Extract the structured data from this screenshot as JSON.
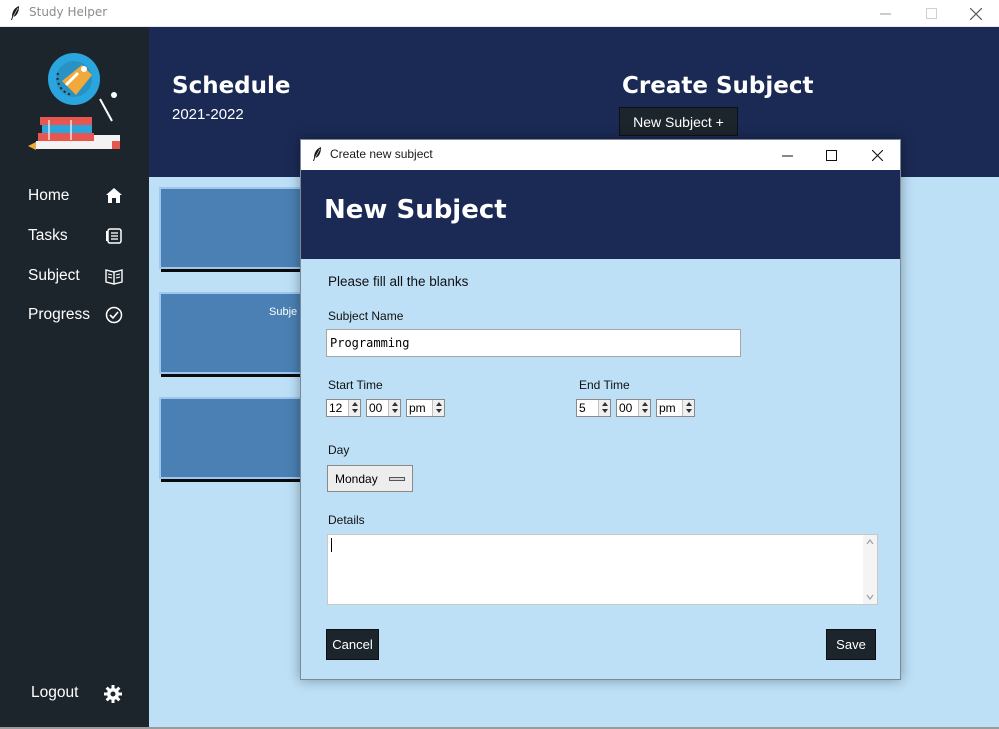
{
  "window": {
    "title": "Study Helper"
  },
  "sidebar": {
    "items": [
      {
        "label": "Home",
        "icon": "home-icon"
      },
      {
        "label": "Tasks",
        "icon": "tasks-icon"
      },
      {
        "label": "Subject",
        "icon": "book-icon"
      },
      {
        "label": "Progress",
        "icon": "check-circle-icon"
      }
    ],
    "logout_label": "Logout",
    "logout_icon": "gear-icon"
  },
  "header": {
    "schedule_title": "Schedule",
    "schedule_year": "2021-2022",
    "create_title": "Create Subject",
    "new_subject_button": "New Subject +"
  },
  "cards": [
    {
      "label": ""
    },
    {
      "label": "Subje"
    },
    {
      "label": ""
    }
  ],
  "dialog": {
    "title": "Create new subject",
    "heading": "New Subject",
    "instruction": "Please fill all the blanks",
    "subject_name_label": "Subject Name",
    "subject_name_value": "Programming",
    "start_time_label": "Start Time",
    "start_hour": "12",
    "start_minute": "00",
    "start_ampm": "pm",
    "end_time_label": "End Time",
    "end_hour": "5",
    "end_minute": "00",
    "end_ampm": "pm",
    "day_label": "Day",
    "day_value": "Monday",
    "details_label": "Details",
    "details_value": "",
    "cancel_button": "Cancel",
    "save_button": "Save"
  },
  "colors": {
    "sidebar_bg": "#1d252c",
    "header_bg": "#1b2a55",
    "content_bg": "#bde0f7",
    "card_bg": "#4a80b3",
    "button_bg": "#1d252c"
  }
}
